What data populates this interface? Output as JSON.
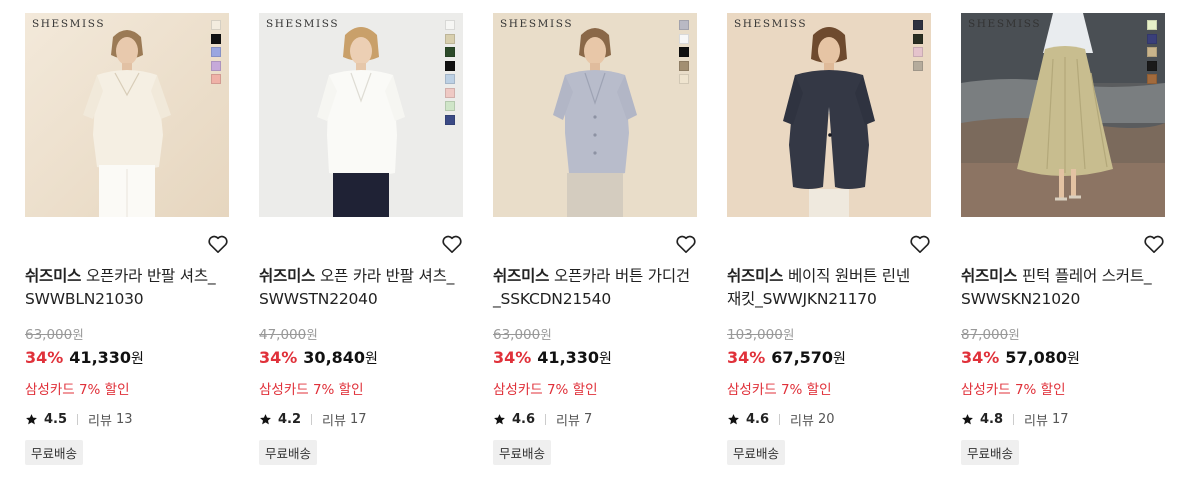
{
  "products": [
    {
      "brand_logo": "SHESMISS",
      "brand": "쉬즈미스",
      "name_line1": "오픈카라 반팔 셔츠_",
      "name_line2": "SWWBLN21030",
      "original_price": "63,000",
      "currency": "원",
      "discount": "34%",
      "sale_price": "41,330",
      "card_promo": "삼성카드 7% 할인",
      "rating": "4.5",
      "reviews_label": "리뷰",
      "reviews_count": "13",
      "shipping": "무료배송",
      "colors": [
        "#f3ecdf",
        "#111111",
        "#9aa6e0",
        "#c6a9d9",
        "#efb1a7"
      ]
    },
    {
      "brand_logo": "SHESMISS",
      "brand": "쉬즈미스",
      "name_line1": "오픈 카라 반팔 셔츠_",
      "name_line2": "SWWSTN22040",
      "original_price": "47,000",
      "currency": "원",
      "discount": "34%",
      "sale_price": "30,840",
      "card_promo": "삼성카드 7% 할인",
      "rating": "4.2",
      "reviews_label": "리뷰",
      "reviews_count": "17",
      "shipping": "무료배송",
      "colors": [
        "#f6f6f4",
        "#d8cfae",
        "#2c4a2a",
        "#111111",
        "#bcd0e4",
        "#efc9c4",
        "#cfe5c8",
        "#3b4a86"
      ]
    },
    {
      "brand_logo": "SHESMISS",
      "brand": "쉬즈미스",
      "name_line1": "오픈카라 버튼 가디건",
      "name_line2": "_SSKCDN21540",
      "original_price": "63,000",
      "currency": "원",
      "discount": "34%",
      "sale_price": "41,330",
      "card_promo": "삼성카드 7% 할인",
      "rating": "4.6",
      "reviews_label": "리뷰",
      "reviews_count": "7",
      "shipping": "무료배송",
      "colors": [
        "#b9b9c4",
        "#f7f7f7",
        "#111111",
        "#a28f72",
        "#efe4cf"
      ]
    },
    {
      "brand_logo": "SHESMISS",
      "brand": "쉬즈미스",
      "name_line1": "베이직 원버튼 린넨",
      "name_line2": "재킷_SWWJKN21170",
      "original_price": "103,000",
      "currency": "원",
      "discount": "34%",
      "sale_price": "67,570",
      "card_promo": "삼성카드 7% 할인",
      "rating": "4.6",
      "reviews_label": "리뷰",
      "reviews_count": "20",
      "shipping": "무료배송",
      "colors": [
        "#2e3140",
        "#2a2e22",
        "#e5c3cc",
        "#b5ab9c"
      ]
    },
    {
      "brand_logo": "SHESMISS",
      "brand": "쉬즈미스",
      "name_line1": "핀턱 플레어 스커트_",
      "name_line2": "SWWSKN21020",
      "original_price": "87,000",
      "currency": "원",
      "discount": "34%",
      "sale_price": "57,080",
      "card_promo": "삼성카드 7% 할인",
      "rating": "4.8",
      "reviews_label": "리뷰",
      "reviews_count": "17",
      "shipping": "무료배송",
      "colors": [
        "#e6f0c8",
        "#3a3f7a",
        "#c9b48b",
        "#1a1a1a",
        "#a26a3c"
      ]
    }
  ]
}
